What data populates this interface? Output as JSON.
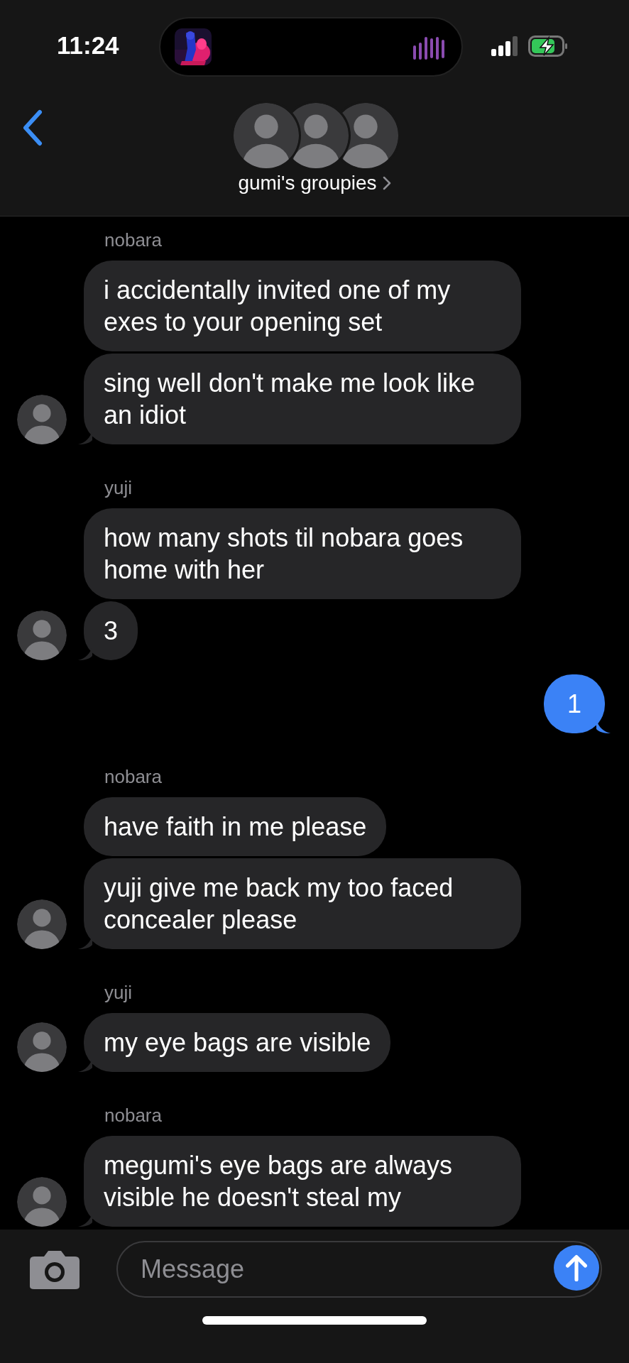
{
  "status_bar": {
    "time": "11:24"
  },
  "header": {
    "title": "gumi's groupies"
  },
  "messages": [
    {
      "kind": "incoming",
      "sender": "nobara",
      "bubbles": [
        "i accidentally invited one of my exes to your opening set",
        "sing well don't make me look like an idiot"
      ]
    },
    {
      "kind": "incoming",
      "sender": "yuji",
      "bubbles": [
        "how many shots til nobara goes home with her",
        "3"
      ]
    },
    {
      "kind": "outgoing",
      "bubbles": [
        "1"
      ]
    },
    {
      "kind": "incoming",
      "sender": "nobara",
      "bubbles": [
        "have faith in me please",
        "yuji give me back my too faced concealer please"
      ]
    },
    {
      "kind": "incoming",
      "sender": "yuji",
      "bubbles": [
        "my eye bags are visible"
      ]
    },
    {
      "kind": "incoming",
      "sender": "nobara",
      "bubbles": [
        "megumi's eye bags are always visible he doesn't steal my"
      ]
    }
  ],
  "composer": {
    "placeholder": "Message"
  }
}
